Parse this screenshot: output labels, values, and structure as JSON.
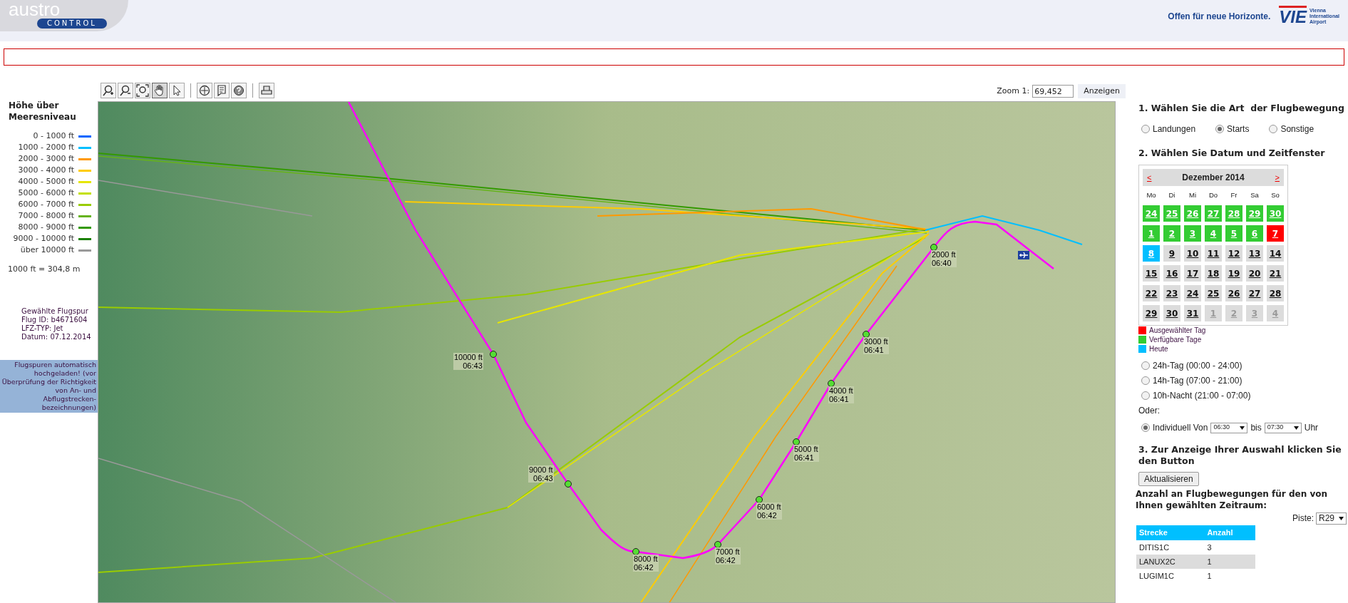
{
  "header": {
    "logo_word": "austro",
    "logo_badge": "CONTROL",
    "slogan": "Offen für neue Horizonte.",
    "airport_logo": "VIE",
    "airport_name": "Vienna International Airport"
  },
  "legend": {
    "title": "Höhe über Meeresniveau",
    "items": [
      {
        "label": "0 - 1000 ft",
        "color": "#0066ff"
      },
      {
        "label": "1000 - 2000 ft",
        "color": "#00bfff"
      },
      {
        "label": "2000 - 3000 ft",
        "color": "#ff9900"
      },
      {
        "label": "3000 - 4000 ft",
        "color": "#ffcc00"
      },
      {
        "label": "4000 - 5000 ft",
        "color": "#e6e600"
      },
      {
        "label": "5000 - 6000 ft",
        "color": "#c3e000"
      },
      {
        "label": "6000 - 7000 ft",
        "color": "#99cc00"
      },
      {
        "label": "7000 - 8000 ft",
        "color": "#66b31a"
      },
      {
        "label": "8000 - 9000 ft",
        "color": "#339900"
      },
      {
        "label": "9000 - 10000 ft",
        "color": "#1a8000"
      },
      {
        "label": "über 10000 ft",
        "color": "#999999"
      }
    ],
    "conversion": "1000 ft = 304,8 m"
  },
  "flight_info": [
    "Gewählte Flugspur",
    "Flug ID: b4671604",
    "LFZ-TYP: Jet",
    "Datum: 07.12.2014"
  ],
  "notice": "Flugspuren automatisch hochgeladen! (vor Überprüfung der Richtigkeit von An- und Abflugstrecken-bezeichnungen)",
  "toolbar": [
    {
      "kind": "zoom-in",
      "selected": false
    },
    {
      "kind": "zoom-out",
      "selected": false
    },
    {
      "kind": "zoom-full",
      "selected": false
    },
    {
      "kind": "pan",
      "selected": true
    },
    {
      "kind": "pointer",
      "selected": false
    },
    {
      "kind": "separator"
    },
    {
      "kind": "identify",
      "selected": false
    },
    {
      "kind": "legend",
      "selected": false
    },
    {
      "kind": "help",
      "selected": false
    },
    {
      "kind": "separator"
    },
    {
      "kind": "print",
      "selected": false
    }
  ],
  "zoom": {
    "label": "Zoom 1:",
    "value": "69,452",
    "button": "Anzeigen"
  },
  "map": {
    "waypoints": [
      {
        "altitude": "2000 ft",
        "time": "06:40"
      },
      {
        "altitude": "3000 ft",
        "time": "06:41"
      },
      {
        "altitude": "4000 ft",
        "time": "06:41"
      },
      {
        "altitude": "5000 ft",
        "time": "06:41"
      },
      {
        "altitude": "6000 ft",
        "time": "06:42"
      },
      {
        "altitude": "7000 ft",
        "time": "06:42"
      },
      {
        "altitude": "8000 ft",
        "time": "06:42"
      },
      {
        "altitude": "9000 ft",
        "time": "06:43"
      },
      {
        "altitude": "10000 ft",
        "time": "06:43"
      }
    ]
  },
  "step1": {
    "heading": "1. Wählen Sie die Art  der Flugbewegung",
    "options": [
      {
        "label": "Landungen",
        "selected": false
      },
      {
        "label": "Starts",
        "selected": true
      },
      {
        "label": "Sonstige",
        "selected": false
      }
    ]
  },
  "step2": {
    "heading": "2. Wählen Sie Datum und Zeitfenster",
    "calendar": {
      "prev": "<",
      "month": "Dezember 2014",
      "next": ">",
      "weekdays": [
        "Mo",
        "Di",
        "Mi",
        "Do",
        "Fr",
        "Sa",
        "So"
      ],
      "weeks": [
        [
          {
            "day": "24",
            "kind": "available"
          },
          {
            "day": "25",
            "kind": "available"
          },
          {
            "day": "26",
            "kind": "available"
          },
          {
            "day": "27",
            "kind": "available"
          },
          {
            "day": "28",
            "kind": "available"
          },
          {
            "day": "29",
            "kind": "available"
          },
          {
            "day": "30",
            "kind": "available"
          }
        ],
        [
          {
            "day": "1",
            "kind": "available"
          },
          {
            "day": "2",
            "kind": "available"
          },
          {
            "day": "3",
            "kind": "available"
          },
          {
            "day": "4",
            "kind": "available"
          },
          {
            "day": "5",
            "kind": "available"
          },
          {
            "day": "6",
            "kind": "available"
          },
          {
            "day": "7",
            "kind": "selected"
          }
        ],
        [
          {
            "day": "8",
            "kind": "today"
          },
          {
            "day": "9",
            "kind": "normal"
          },
          {
            "day": "10",
            "kind": "normal"
          },
          {
            "day": "11",
            "kind": "normal"
          },
          {
            "day": "12",
            "kind": "normal"
          },
          {
            "day": "13",
            "kind": "normal"
          },
          {
            "day": "14",
            "kind": "normal"
          }
        ],
        [
          {
            "day": "15",
            "kind": "normal"
          },
          {
            "day": "16",
            "kind": "normal"
          },
          {
            "day": "17",
            "kind": "normal"
          },
          {
            "day": "18",
            "kind": "normal"
          },
          {
            "day": "19",
            "kind": "normal"
          },
          {
            "day": "20",
            "kind": "normal"
          },
          {
            "day": "21",
            "kind": "normal"
          }
        ],
        [
          {
            "day": "22",
            "kind": "normal"
          },
          {
            "day": "23",
            "kind": "normal"
          },
          {
            "day": "24",
            "kind": "normal"
          },
          {
            "day": "25",
            "kind": "normal"
          },
          {
            "day": "26",
            "kind": "normal"
          },
          {
            "day": "27",
            "kind": "normal"
          },
          {
            "day": "28",
            "kind": "normal"
          }
        ],
        [
          {
            "day": "29",
            "kind": "normal"
          },
          {
            "day": "30",
            "kind": "normal"
          },
          {
            "day": "31",
            "kind": "normal"
          },
          {
            "day": "1",
            "kind": "other"
          },
          {
            "day": "2",
            "kind": "other"
          },
          {
            "day": "3",
            "kind": "other"
          },
          {
            "day": "4",
            "kind": "other"
          }
        ]
      ]
    },
    "calendar_legend": [
      {
        "label": "Ausgewählter Tag",
        "color": "#ff0000"
      },
      {
        "label": "Verfügbare Tage",
        "color": "#33cc33"
      },
      {
        "label": "Heute",
        "color": "#00bfff"
      }
    ],
    "time_windows": [
      {
        "label": "24h-Tag (00:00 - 24:00)",
        "selected": false
      },
      {
        "label": "14h-Tag (07:00 - 21:00)",
        "selected": false
      },
      {
        "label": "10h-Nacht (21:00 - 07:00)",
        "selected": false
      }
    ],
    "or_label": "Oder:",
    "custom": {
      "label": "Individuell Von",
      "selected": true,
      "from": "06:30",
      "between": "bis",
      "to": "07:30",
      "unit": "Uhr"
    }
  },
  "step3": {
    "heading": "3. Zur Anzeige Ihrer Auswahl klicken Sie den Button",
    "button": "Aktualisieren"
  },
  "counts": {
    "heading": "Anzahl an Flugbewegungen für den von Ihnen gewählten Zeitraum:",
    "runway_label": "Piste:",
    "runway": "R29",
    "columns": [
      "Strecke",
      "Anzahl"
    ],
    "rows": [
      [
        "DITIS1C",
        "3"
      ],
      [
        "LANUX2C",
        "1"
      ],
      [
        "LUGIM1C",
        "1"
      ]
    ]
  }
}
